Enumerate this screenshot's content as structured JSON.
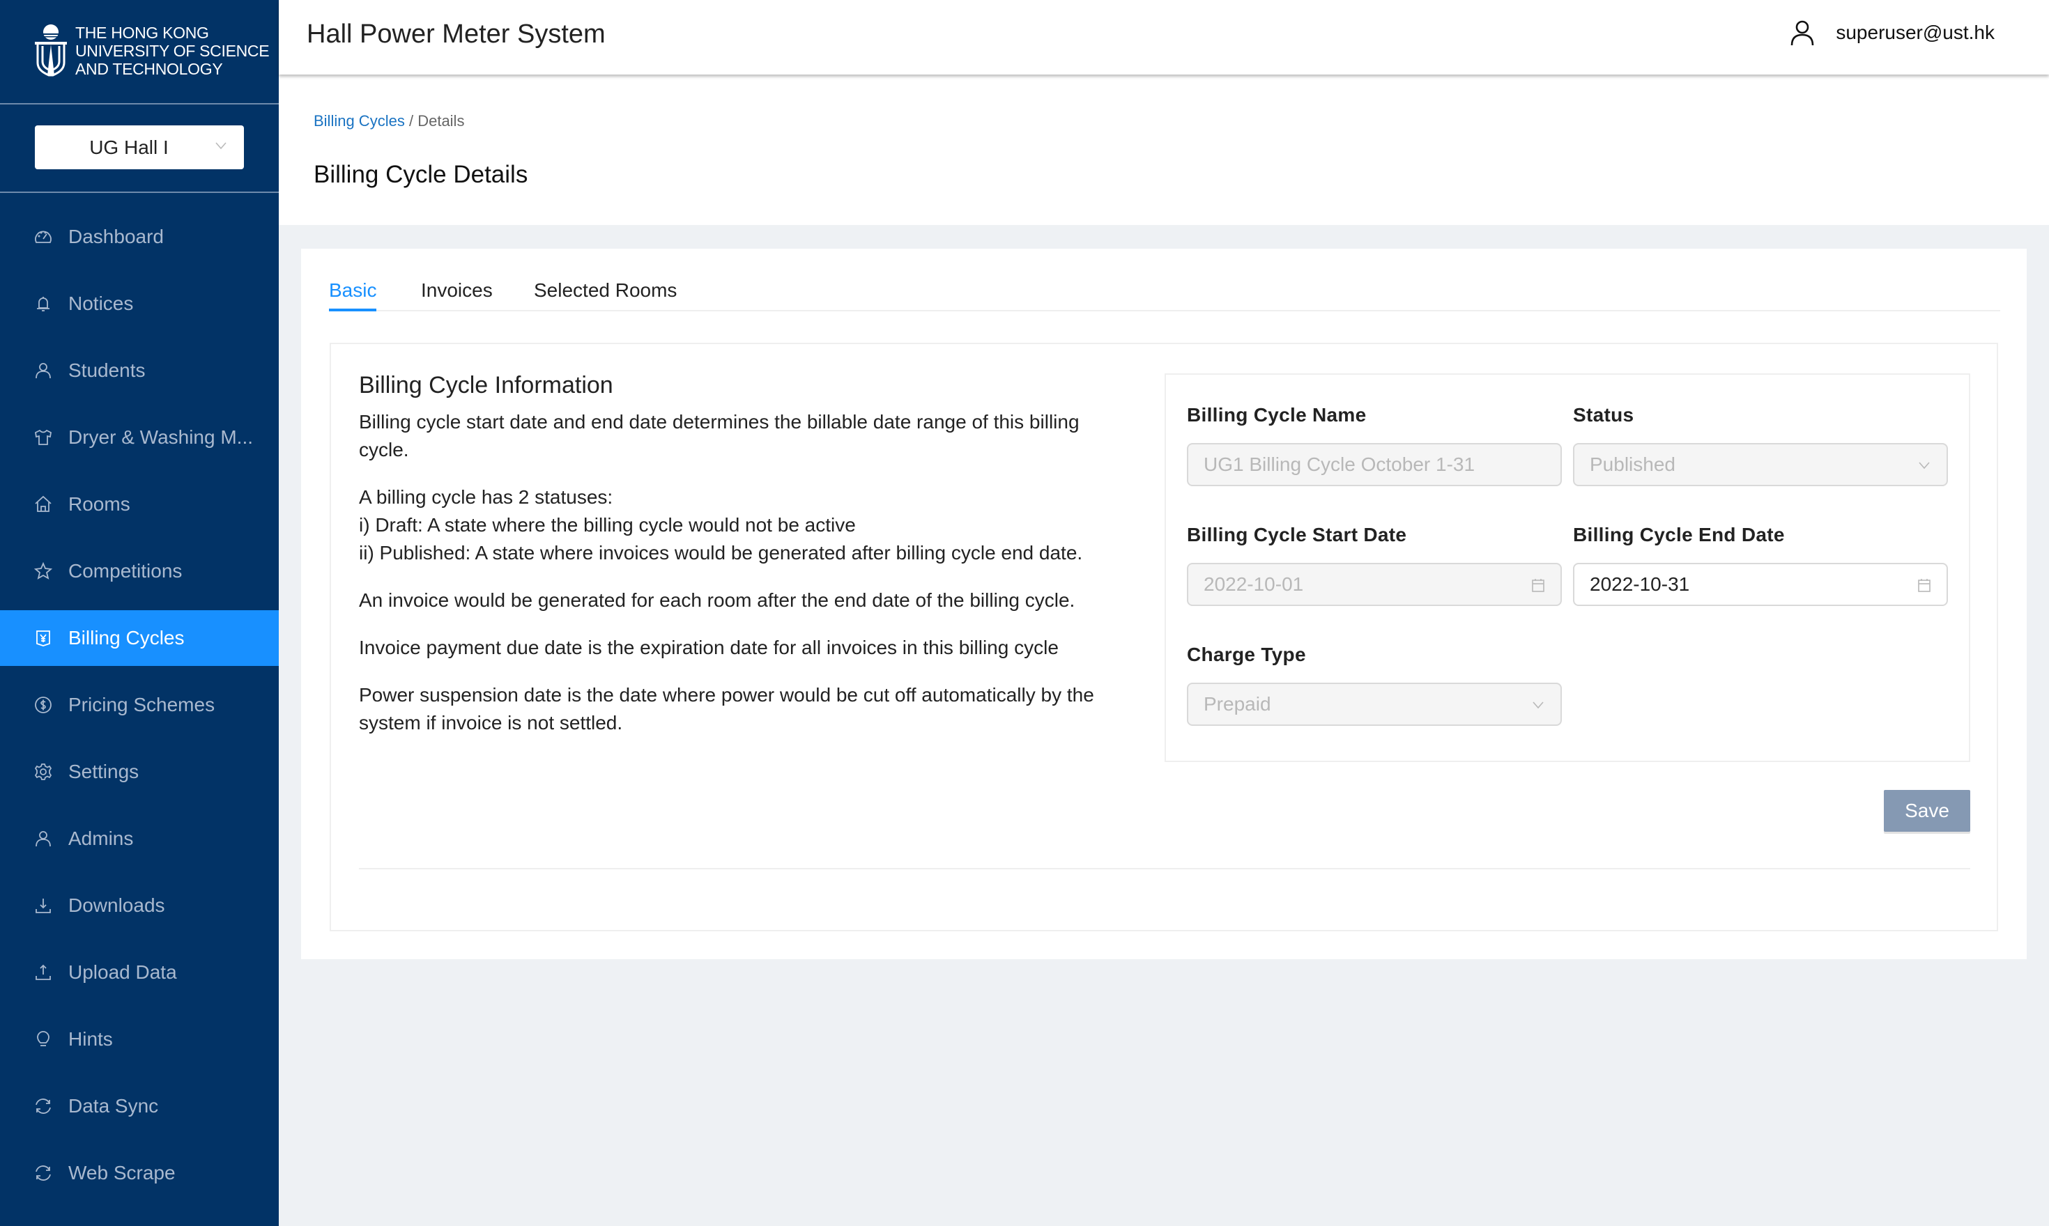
{
  "sidebar": {
    "logo": {
      "line1": "The Hong Kong",
      "line2": "University of Science",
      "line3": "and Technology"
    },
    "hall_select": {
      "value": "UG Hall I"
    },
    "items": [
      {
        "label": "Dashboard",
        "icon": "dashboard-icon"
      },
      {
        "label": "Notices",
        "icon": "bell-icon"
      },
      {
        "label": "Students",
        "icon": "user-icon"
      },
      {
        "label": "Dryer & Washing M...",
        "icon": "shirt-icon"
      },
      {
        "label": "Rooms",
        "icon": "home-icon"
      },
      {
        "label": "Competitions",
        "icon": "star-icon"
      },
      {
        "label": "Billing Cycles",
        "icon": "billing-icon",
        "active": true
      },
      {
        "label": "Pricing Schemes",
        "icon": "dollar-icon"
      },
      {
        "label": "Settings",
        "icon": "gear-icon"
      },
      {
        "label": "Admins",
        "icon": "user-icon"
      },
      {
        "label": "Downloads",
        "icon": "download-icon"
      },
      {
        "label": "Upload Data",
        "icon": "upload-icon"
      },
      {
        "label": "Hints",
        "icon": "bulb-icon"
      },
      {
        "label": "Data Sync",
        "icon": "sync-icon"
      },
      {
        "label": "Web Scrape",
        "icon": "sync-icon"
      }
    ],
    "colors": {
      "background": "#023366",
      "active": "#1890ff"
    }
  },
  "header": {
    "title": "Hall Power Meter System",
    "user_email": "superuser@ust.hk"
  },
  "page": {
    "breadcrumb": {
      "parent": "Billing Cycles",
      "separator": "/",
      "current": "Details"
    },
    "title": "Billing Cycle Details"
  },
  "tabs": [
    {
      "label": "Basic",
      "active": true
    },
    {
      "label": "Invoices"
    },
    {
      "label": "Selected Rooms"
    }
  ],
  "info": {
    "title": "Billing Cycle Information",
    "paragraphs": [
      "Billing cycle start date and end date determines the billable date range of this billing cycle.",
      "A billing cycle has 2 statuses:",
      "i) Draft: A state where the billing cycle would not be active",
      "ii) Published: A state where invoices would be generated after billing cycle end date.",
      "An invoice would be generated for each room after the end date of the billing cycle.",
      "Invoice payment due date is the expiration date for all invoices in this billing cycle",
      "Power suspension date is the date where power would be cut off automatically by the system if invoice is not settled."
    ]
  },
  "form": {
    "name": {
      "label": "Billing Cycle Name",
      "value": "UG1 Billing Cycle October 1-31",
      "disabled": true
    },
    "status": {
      "label": "Status",
      "value": "Published",
      "disabled": true
    },
    "start_date": {
      "label": "Billing Cycle Start Date",
      "value": "2022-10-01",
      "disabled": true
    },
    "end_date": {
      "label": "Billing Cycle End Date",
      "value": "2022-10-31",
      "disabled": false
    },
    "charge_type": {
      "label": "Charge Type",
      "value": "Prepaid",
      "disabled": true
    },
    "save_label": "Save"
  }
}
